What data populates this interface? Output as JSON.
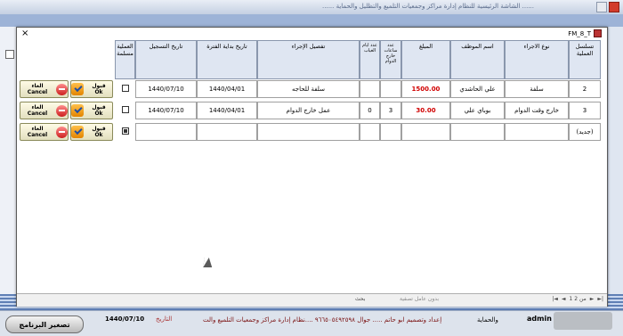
{
  "app_title": "...... الشاشة الرئيسية للنظام إدارة مراكز وجمعيات التلميع والتظليل والحماية ......",
  "dialog": {
    "title": "FM_8_T",
    "close_glyph": "×",
    "headers": {
      "seq": "تسلسل العملية",
      "type": "نوع الاجراء",
      "employee": "اسم الموظف",
      "amount": "المبلغ",
      "overtime_hours": "عدد ساعات خارج الدوام",
      "absence_days": "عدد ايام الغياب",
      "details": "تفصيل الإجراء",
      "period_start": "تاريخ بداية الفترة",
      "reg_date": "تاريخ التسجيل",
      "delivered": "العملية مسلمة"
    },
    "rows": [
      {
        "seq": "2",
        "type": "سلفة",
        "employee": "علي الحاشدي",
        "amount": "1500.00",
        "overtime_hours": "",
        "absence_days": "",
        "details": "سلفة للحاجه",
        "period_start": "1440/04/01",
        "reg_date": "1440/07/10",
        "delivered": false
      },
      {
        "seq": "3",
        "type": "خارج وقت الدوام",
        "employee": "بوباي علي",
        "amount": "30.00",
        "overtime_hours": "3",
        "absence_days": "0",
        "details": "عمل خارج الدوام",
        "period_start": "1440/04/01",
        "reg_date": "1440/07/10",
        "delivered": false
      },
      {
        "seq": "(جديد)",
        "type": "",
        "employee": "",
        "amount": "",
        "overtime_hours": "",
        "absence_days": "",
        "details": "",
        "period_start": "",
        "reg_date": "",
        "delivered": true
      }
    ],
    "buttons": {
      "ok_ar": "قبول",
      "ok_en": "Ok",
      "cancel_ar": "الغاء",
      "cancel_en": "Cancel"
    },
    "navigator": {
      "record": "1 من 2",
      "search_label": "بحث",
      "filter_label": "بدون عامل تصفية"
    }
  },
  "status": {
    "exit_label": "تصغير البرنامج",
    "date": "1440/07/10",
    "date_label": "التاريخ",
    "credit": "إعداد وتصميم ابو حاتم ..... جوال ٩٦٦٥٠٥٤٩٢٥٩٨ ....نظام إدارة مراكز وجمعيات التلميع والت",
    "user": "admin",
    "mode": "والحماية"
  },
  "colors": {
    "amount_red": "#d10000",
    "header_bg": "#dfe6f2"
  }
}
